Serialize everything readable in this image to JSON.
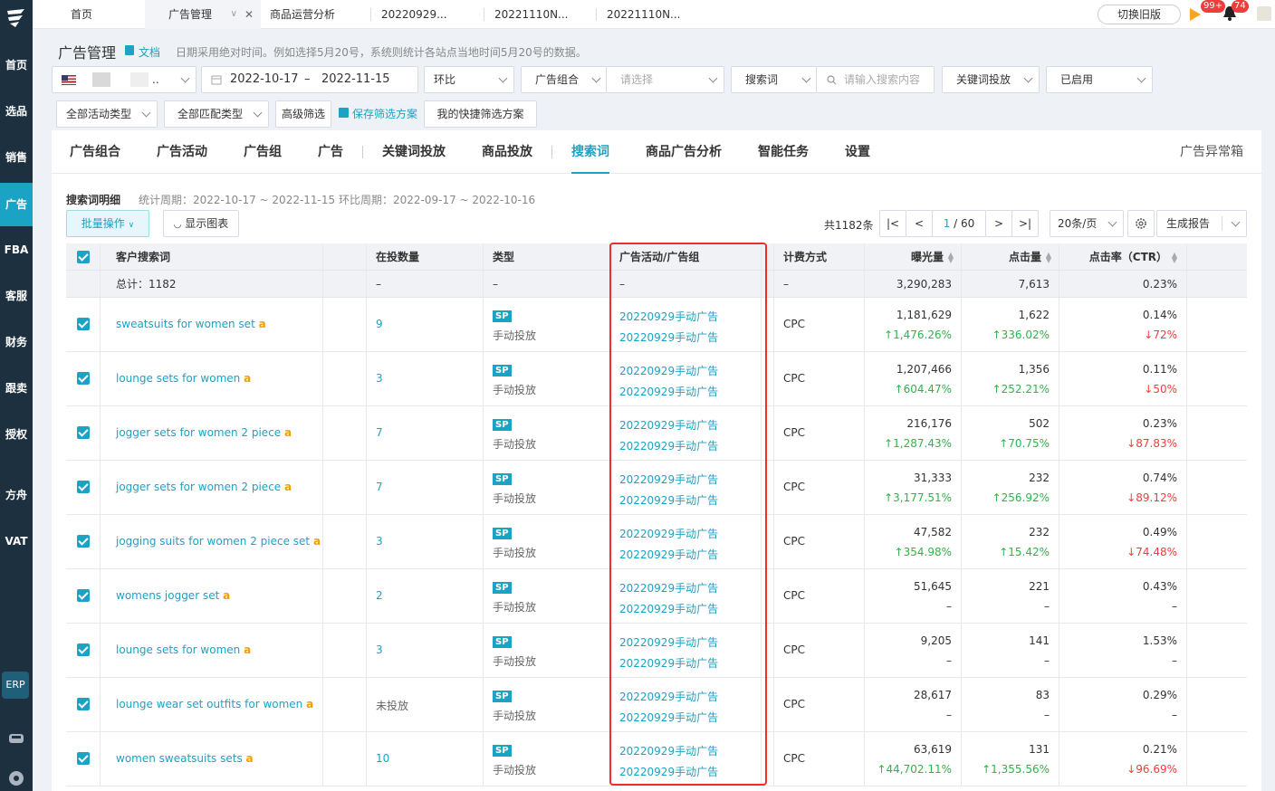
{
  "sidebar": {
    "items": [
      "首页",
      "选品",
      "销售",
      "广告",
      "FBA",
      "客服",
      "财务",
      "跟卖",
      "授权",
      "方舟",
      "VAT"
    ],
    "active": "广告",
    "erp_label": "ERP"
  },
  "topbar": {
    "tabs": [
      "首页",
      "广告管理",
      "商品运营分析",
      "20220929...",
      "20221110N...",
      "20221110N..."
    ],
    "switch_label": "切换旧版",
    "flag_badge": "99+",
    "bell_badge": "74"
  },
  "header": {
    "title": "广告管理",
    "doc_label": "文档",
    "note": "日期采用绝对时间。例如选择5月20号，系统则统计各站点当地时间5月20号的数据。"
  },
  "filters": {
    "store_suffix": "..",
    "date_start": "2022-10-17",
    "date_sep": "–",
    "date_end": "2022-11-15",
    "compare": "环比",
    "group_type": "广告组合",
    "group_placeholder": "请选择",
    "search_type": "搜索词",
    "search_placeholder": "请输入搜索内容",
    "keyword_type": "关键词投放",
    "status": "已启用",
    "activity_type": "全部活动类型",
    "match_type": "全部匹配类型",
    "advanced": "高级筛选",
    "save_scheme": "保存筛选方案",
    "my_scheme": "我的快捷筛选方案"
  },
  "main_tabs": [
    "广告组合",
    "广告活动",
    "广告组",
    "广告",
    "关键词投放",
    "商品投放",
    "搜索词",
    "商品广告分析",
    "智能任务",
    "设置"
  ],
  "active_tab": "搜索词",
  "abnormal_box": "广告异常箱",
  "section": {
    "title": "搜索词明细",
    "period": "统计周期：2022-10-17 ~ 2022-11-15 环比周期：2022-09-17 ~ 2022-10-16",
    "batch": "批量操作",
    "show_chart": "显示图表",
    "total": "共1182条",
    "page": "1",
    "pages": "/ 60",
    "page_size": "20条/页",
    "report": "生成报告"
  },
  "table": {
    "headers": [
      "客户搜索词",
      "在投数量",
      "类型",
      "广告活动/广告组",
      "计费方式",
      "曝光量",
      "点击量",
      "点击率（CTR）"
    ],
    "summary": {
      "label": "总计：1182",
      "count": "–",
      "type": "–",
      "campaign": "–",
      "billing": "–",
      "impressions": "3,290,283",
      "clicks": "7,613",
      "ctr": "0.23%"
    },
    "rows": [
      {
        "term": "sweatsuits for women set",
        "count": "9",
        "sp": "SP",
        "type": "手动投放",
        "camp": "20220929手动广告",
        "group": "20220929手动广告",
        "billing": "CPC",
        "impr": "1,181,629",
        "impr_chg": "↑1,476.26%",
        "impr_dir": "up",
        "clicks": "1,622",
        "clicks_chg": "↑336.02%",
        "clicks_dir": "up",
        "ctr": "0.14%",
        "ctr_chg": "↓72%",
        "ctr_dir": "dn"
      },
      {
        "term": "lounge sets for women",
        "count": "3",
        "sp": "SP",
        "type": "手动投放",
        "camp": "20220929手动广告",
        "group": "20220929手动广告",
        "billing": "CPC",
        "impr": "1,207,466",
        "impr_chg": "↑604.47%",
        "impr_dir": "up",
        "clicks": "1,356",
        "clicks_chg": "↑252.21%",
        "clicks_dir": "up",
        "ctr": "0.11%",
        "ctr_chg": "↓50%",
        "ctr_dir": "dn"
      },
      {
        "term": "jogger sets for women 2 piece",
        "count": "7",
        "sp": "SP",
        "type": "手动投放",
        "camp": "20220929手动广告",
        "group": "20220929手动广告",
        "billing": "CPC",
        "impr": "216,176",
        "impr_chg": "↑1,287.43%",
        "impr_dir": "up",
        "clicks": "502",
        "clicks_chg": "↑70.75%",
        "clicks_dir": "up",
        "ctr": "0.23%",
        "ctr_chg": "↓87.83%",
        "ctr_dir": "dn"
      },
      {
        "term": "jogger sets for women 2 piece",
        "count": "7",
        "sp": "SP",
        "type": "手动投放",
        "camp": "20220929手动广告",
        "group": "20220929手动广告",
        "billing": "CPC",
        "impr": "31,333",
        "impr_chg": "↑3,177.51%",
        "impr_dir": "up",
        "clicks": "232",
        "clicks_chg": "↑256.92%",
        "clicks_dir": "up",
        "ctr": "0.74%",
        "ctr_chg": "↓89.12%",
        "ctr_dir": "dn"
      },
      {
        "term": "jogging suits for women 2 piece set",
        "count": "3",
        "sp": "SP",
        "type": "手动投放",
        "camp": "20220929手动广告",
        "group": "20220929手动广告",
        "billing": "CPC",
        "impr": "47,582",
        "impr_chg": "↑354.98%",
        "impr_dir": "up",
        "clicks": "232",
        "clicks_chg": "↑15.42%",
        "clicks_dir": "up",
        "ctr": "0.49%",
        "ctr_chg": "↓74.48%",
        "ctr_dir": "dn"
      },
      {
        "term": "womens jogger set",
        "count": "2",
        "sp": "SP",
        "type": "手动投放",
        "camp": "20220929手动广告",
        "group": "20220929手动广告",
        "billing": "CPC",
        "impr": "51,645",
        "impr_chg": "–",
        "impr_dir": "",
        "clicks": "221",
        "clicks_chg": "–",
        "clicks_dir": "",
        "ctr": "0.43%",
        "ctr_chg": "–",
        "ctr_dir": ""
      },
      {
        "term": "lounge sets for women",
        "count": "3",
        "sp": "SP",
        "type": "手动投放",
        "camp": "20220929手动广告",
        "group": "20220929手动广告",
        "billing": "CPC",
        "impr": "9,205",
        "impr_chg": "–",
        "impr_dir": "",
        "clicks": "141",
        "clicks_chg": "–",
        "clicks_dir": "",
        "ctr": "1.53%",
        "ctr_chg": "–",
        "ctr_dir": ""
      },
      {
        "term": "lounge wear set outfits for women",
        "count": "未投放",
        "sp": "SP",
        "type": "手动投放",
        "camp": "20220929手动广告",
        "group": "20220929手动广告",
        "billing": "CPC",
        "impr": "28,617",
        "impr_chg": "–",
        "impr_dir": "",
        "clicks": "83",
        "clicks_chg": "–",
        "clicks_dir": "",
        "ctr": "0.29%",
        "ctr_chg": "–",
        "ctr_dir": ""
      },
      {
        "term": "women sweatsuits sets",
        "count": "10",
        "sp": "SP",
        "type": "手动投放",
        "camp": "20220929手动广告",
        "group": "20220929手动广告",
        "billing": "CPC",
        "impr": "63,619",
        "impr_chg": "↑44,702.11%",
        "impr_dir": "up",
        "clicks": "131",
        "clicks_chg": "↑1,355.56%",
        "clicks_dir": "up",
        "ctr": "0.21%",
        "ctr_chg": "↓96.69%",
        "ctr_dir": "dn"
      }
    ]
  },
  "colors": {
    "accent": "#1aa3c4",
    "sidebar": "#1d3040",
    "up": "#2cb54b",
    "down": "#f23c3c",
    "highlight_box": "#f02c2c"
  }
}
